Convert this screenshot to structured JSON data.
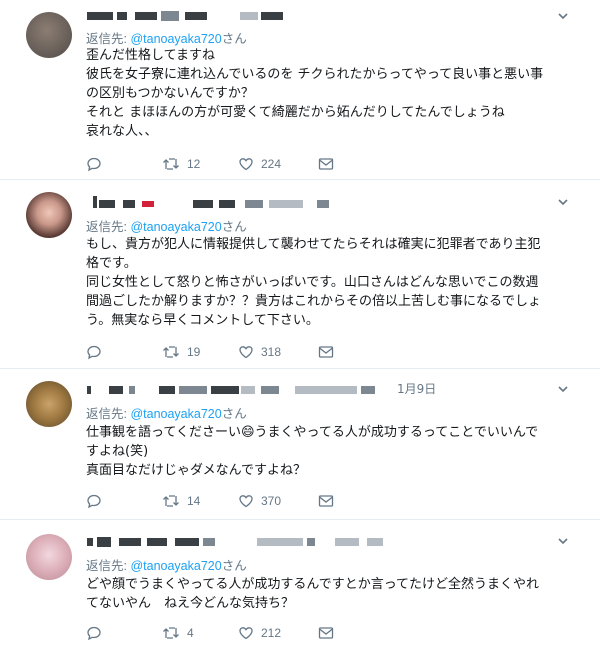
{
  "tweets": [
    {
      "reply_prefix": "返信先: ",
      "reply_handle": "@tanoayaka720",
      "reply_suffix": "さん",
      "date": "",
      "lines": [
        "歪んだ性格してますね",
        "彼氏を女子寮に連れ込んでいるのを チクられたからってやって良い事と悪い事",
        "の区別もつかないんですか？",
        "それと まほほんの方が可愛くて綺麗だから妬んだりしてたんでしょうね",
        "哀れな人、、"
      ],
      "retweets": "12",
      "likes": "224"
    },
    {
      "reply_prefix": "返信先: ",
      "reply_handle": "@tanoayaka720",
      "reply_suffix": "さん",
      "date": "",
      "lines": [
        "もし、貴方が犯人に情報提供して襲わせてたらそれは確実に犯罪者であり主犯",
        "格です。",
        "同じ女性として怒りと怖さがいっぱいです。山口さんはどんな思いでこの数週",
        "間過ごしたか解りますか？？貴方はこれからその倍以上苦しむ事になるでしょ",
        "う。無実なら早くコメントして下さい。"
      ],
      "retweets": "19",
      "likes": "318"
    },
    {
      "reply_prefix": "返信先: ",
      "reply_handle": "@tanoayaka720",
      "reply_suffix": "さん",
      "date": "1月9日",
      "lines": [
        "仕事観を語ってくださーい😄うまくやってる人が成功するってことでいいんで",
        "すよね(笑)",
        "真面目なだけじゃダメなんですよね？"
      ],
      "retweets": "14",
      "likes": "370"
    },
    {
      "reply_prefix": "返信先: ",
      "reply_handle": "@tanoayaka720",
      "reply_suffix": "さん",
      "date": "",
      "lines": [
        "どや顔でうまくやってる人が成功するんですとか言ってたけど全然うまくやれ",
        "てないやん　ねえ今どんな気持ち？"
      ],
      "retweets": "4",
      "likes": "212"
    }
  ],
  "icons": {
    "reply": "reply-icon",
    "retweet": "retweet-icon",
    "like": "heart-icon",
    "dm": "envelope-icon",
    "menu": "chevron-down-icon"
  },
  "colors": {
    "link": "#1da1f2",
    "muted": "#657786",
    "text": "#14171a",
    "divider": "#e6ecf0"
  }
}
